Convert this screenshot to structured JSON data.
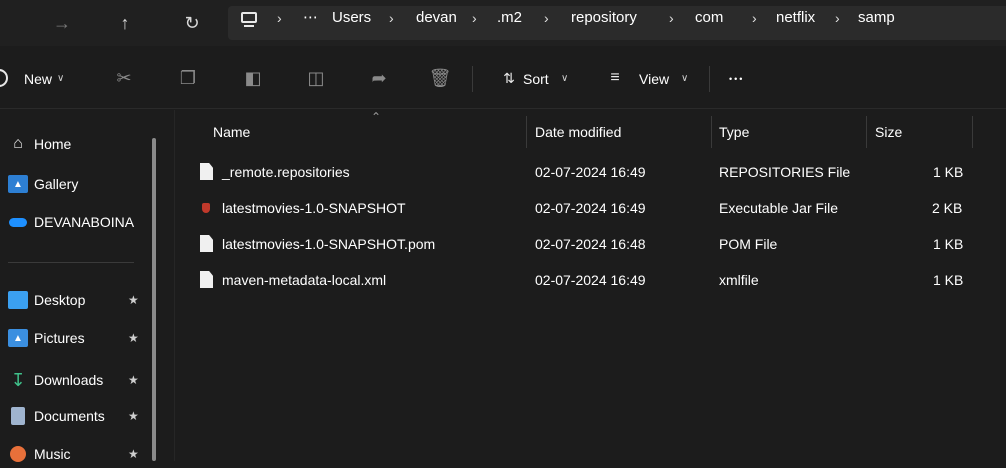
{
  "address": {
    "crumbs": [
      "Users",
      "devan",
      ".m2",
      "repository",
      "com",
      "netflix",
      "samp"
    ],
    "more_label": "⋯",
    "separator": "›"
  },
  "toolbar": {
    "new_label": "New",
    "sort_label": "Sort",
    "view_label": "View",
    "more_label": "•••",
    "chevron": "∨"
  },
  "sidebar": {
    "items": [
      {
        "label": "Home",
        "icon": "home-icon"
      },
      {
        "label": "Gallery",
        "icon": "gallery-icon"
      },
      {
        "label": "DEVANABOINA",
        "icon": "onedrive-icon"
      },
      {
        "label": "Desktop",
        "icon": "desktop-icon",
        "pinned": true
      },
      {
        "label": "Pictures",
        "icon": "pictures-icon",
        "pinned": true
      },
      {
        "label": "Downloads",
        "icon": "downloads-icon",
        "pinned": true
      },
      {
        "label": "Documents",
        "icon": "documents-icon",
        "pinned": true
      },
      {
        "label": "Music",
        "icon": "music-icon",
        "pinned": true
      }
    ]
  },
  "columns": {
    "name": "Name",
    "date": "Date modified",
    "type": "Type",
    "size": "Size"
  },
  "files": [
    {
      "name": "_remote.repositories",
      "date": "02-07-2024 16:49",
      "type": "REPOSITORIES File",
      "size": "1 KB",
      "icon": "file-icon"
    },
    {
      "name": "latestmovies-1.0-SNAPSHOT",
      "date": "02-07-2024 16:49",
      "type": "Executable Jar File",
      "size": "2 KB",
      "icon": "jar-icon"
    },
    {
      "name": "latestmovies-1.0-SNAPSHOT.pom",
      "date": "02-07-2024 16:48",
      "type": "POM File",
      "size": "1 KB",
      "icon": "file-icon"
    },
    {
      "name": "maven-metadata-local.xml",
      "date": "02-07-2024 16:49",
      "type": "xmlfile",
      "size": "1 KB",
      "icon": "file-icon"
    }
  ],
  "colors": {
    "accent": "#4cc2ff",
    "background": "#1c1c1c",
    "addressbar": "#202020"
  }
}
